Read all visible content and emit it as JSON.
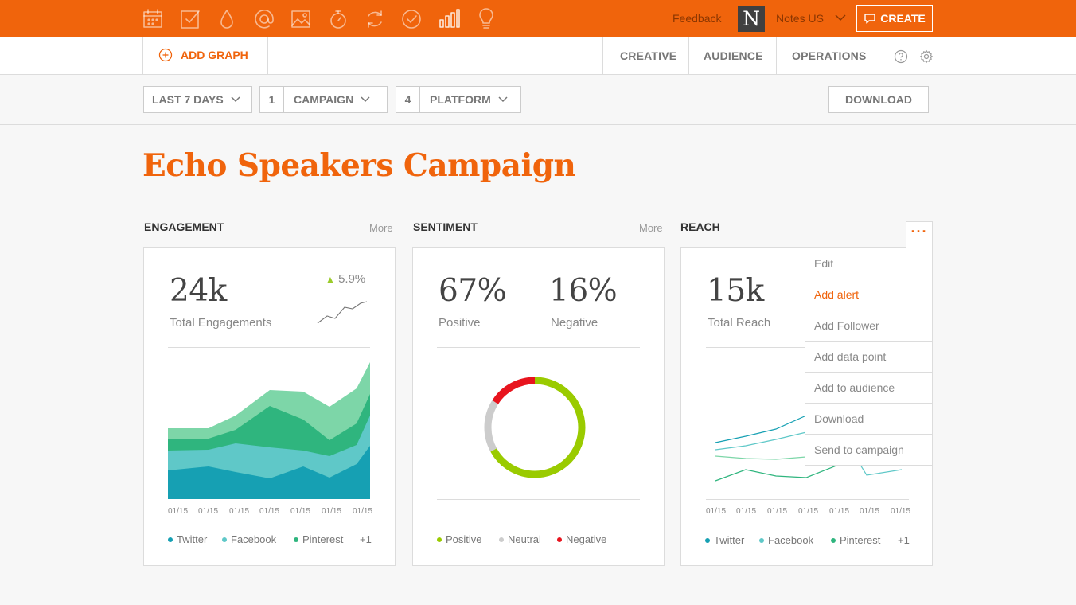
{
  "topbar": {
    "icons": [
      "calendar-icon",
      "checkbox-icon",
      "drop-icon",
      "at-icon",
      "image-icon",
      "timer-icon",
      "refresh-icon",
      "check-circle-icon",
      "bar-chart-icon",
      "lightbulb-icon"
    ],
    "feedback": "Feedback",
    "logo_letter": "N",
    "account": "Notes US",
    "create_label": "CREATE"
  },
  "subnav": {
    "add_graph": "ADD GRAPH",
    "tabs": [
      "CREATIVE",
      "AUDIENCE",
      "OPERATIONS"
    ]
  },
  "filters": {
    "date_range": "LAST 7 DAYS",
    "campaign_count": "1",
    "campaign_label": "CAMPAIGN",
    "platform_count": "4",
    "platform_label": "PLATFORM",
    "download": "DOWNLOAD"
  },
  "page_title": "Echo Speakers Campaign",
  "cards": {
    "engagement": {
      "label": "ENGAGEMENT",
      "more": "More",
      "value": "24k",
      "caption": "Total Engagements",
      "trend": "5.9%",
      "legend": [
        "Twitter",
        "Facebook",
        "Pinterest",
        "+1"
      ]
    },
    "sentiment": {
      "label": "SENTIMENT",
      "more": "More",
      "positive_value": "67%",
      "positive_caption": "Positive",
      "negative_value": "16%",
      "negative_caption": "Negative",
      "legend": [
        "Positive",
        "Neutral",
        "Negative"
      ]
    },
    "reach": {
      "label": "REACH",
      "more_dots": "···",
      "value": "15k",
      "caption": "Total Reach",
      "legend": [
        "Twitter",
        "Facebook",
        "Pinterest",
        "+1"
      ]
    }
  },
  "x_ticks": [
    "01/15",
    "01/15",
    "01/15",
    "01/15",
    "01/15",
    "01/15",
    "01/15"
  ],
  "dropdown_menu": [
    "Edit",
    "Add alert",
    "Add Follower",
    "Add data point",
    "Add to audience",
    "Download",
    "Send to campaign"
  ],
  "colors": {
    "brand": "#f0640c",
    "twitter": "#16a0b3",
    "facebook": "#5fc8c8",
    "pinterest": "#2fb57e",
    "other": "#7dd6a8",
    "positive": "#9acb00",
    "neutral": "#cccccc",
    "negative": "#e8141e"
  }
}
